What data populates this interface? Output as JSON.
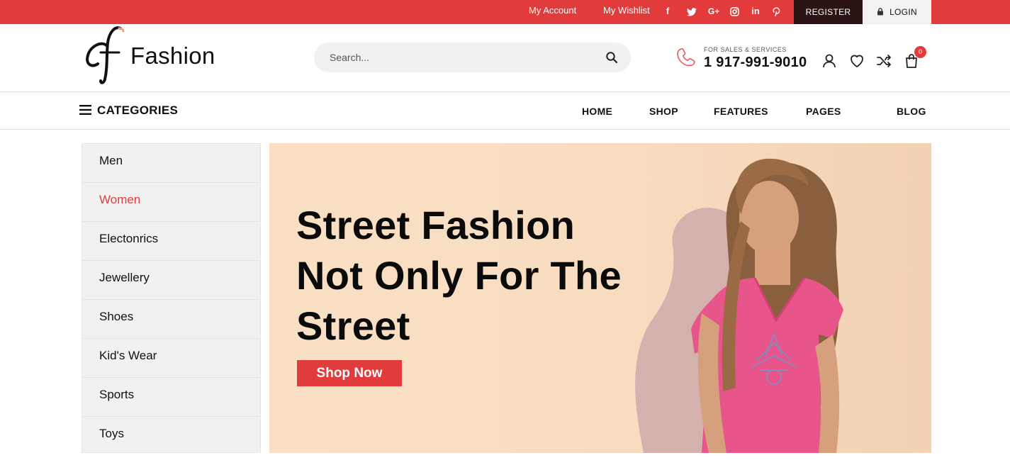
{
  "topbar": {
    "my_account": "My Account",
    "my_wishlist": "My Wishlist",
    "social": [
      "f",
      "twitter",
      "G+",
      "instagram",
      "in",
      "pinterest"
    ],
    "social_labels": {
      "facebook": "f",
      "google": "G+",
      "linkedin": "in"
    },
    "register": "REGISTER",
    "login": "LOGIN",
    "accent_color": "#e23b3c",
    "register_bg": "#2b1213"
  },
  "header": {
    "logo_text": "Fashion",
    "logo_mark": "cf",
    "search_placeholder": "Search...",
    "phone_caption": "FOR SALES & SERVICES",
    "phone_number": "1 917-991-9010",
    "cart_count": "0"
  },
  "nav": {
    "categories_label": "CATEGORIES",
    "links": [
      "HOME",
      "SHOP",
      "FEATURES",
      "PAGES",
      "BLOG"
    ]
  },
  "sidebar": {
    "items": [
      "Men",
      "Women",
      "Electonrics",
      "Jewellery",
      "Shoes",
      "Kid's Wear",
      "Sports",
      "Toys"
    ],
    "active_index": 1
  },
  "hero": {
    "headline_lines": [
      "Street Fashion",
      "Not Only For The",
      "Street"
    ],
    "cta_label": "Shop Now"
  },
  "icons": {
    "search": "search-icon",
    "phone": "phone-icon",
    "user": "user-icon",
    "wishlist": "heart-icon",
    "compare": "shuffle-icon",
    "cart": "shopping-bag-icon",
    "lock": "lock-icon",
    "menu": "hamburger-icon"
  }
}
